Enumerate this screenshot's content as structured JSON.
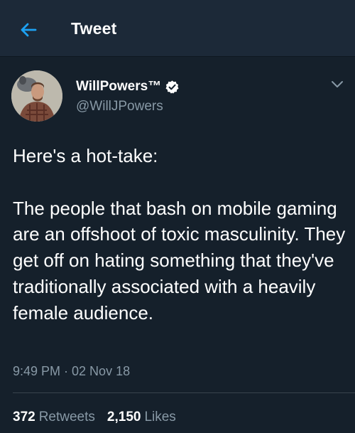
{
  "header": {
    "title": "Tweet",
    "back_icon": "arrow-left-icon"
  },
  "tweet": {
    "display_name": "WillPowers™",
    "handle": "@WillJPowers",
    "verified_icon": "verified-badge-icon",
    "menu_icon": "chevron-down-icon",
    "text": "Here's a hot-take:\n\nThe people that bash on mobile gaming are an offshoot of toxic masculinity. They get off on hating something that they've traditionally associated with a heavily female audience.",
    "timestamp": "9:49 PM · 02 Nov 18",
    "retweets_count": "372",
    "retweets_label": "Retweets",
    "likes_count": "2,150",
    "likes_label": "Likes"
  },
  "colors": {
    "background": "#15202b",
    "header_background": "#1c2938",
    "accent": "#1da1f2",
    "secondary_text": "#8899a6",
    "divider": "#38444d"
  }
}
